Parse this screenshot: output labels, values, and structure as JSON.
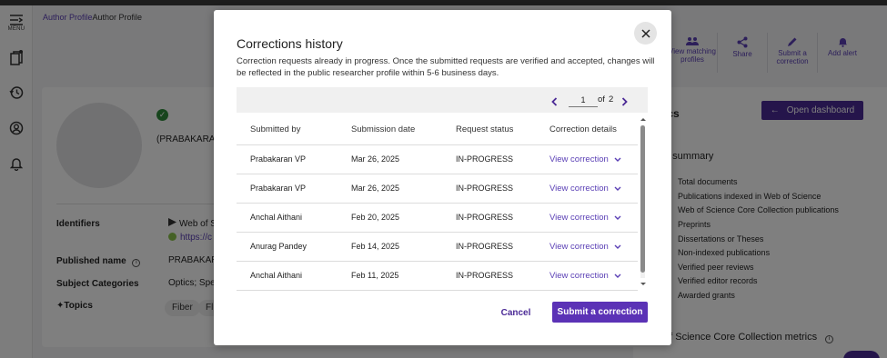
{
  "nav": {
    "menu_label": "MENU"
  },
  "breadcrumb": {
    "first": "Author Profile",
    "second": "Author Profile"
  },
  "actions": [
    {
      "label": "View matching profiles",
      "icon": "people-icon"
    },
    {
      "label": "Share",
      "icon": "share-icon"
    },
    {
      "label": "Submit a correction",
      "icon": "pencil-icon"
    },
    {
      "label": "Add alert",
      "icon": "bell-icon"
    }
  ],
  "profile": {
    "name_partial": "(PRABAKARAN,",
    "identifiers_label": "Identifiers",
    "identifier_source": "Web of S",
    "identifier_link": "https://c",
    "published_name_label": "Published name",
    "published_name_value": "PRABAKARAN",
    "subject_categories_label": "Subject Categories",
    "subject_categories_value": "Optics;  Spe",
    "topics_label": "Topics",
    "topic_chips": [
      "Fiber",
      "Fl"
    ]
  },
  "metrics": {
    "open_dashboard": "Open dashboard",
    "title": "ics",
    "summary_title": "e summary",
    "summary_items": [
      "Total documents",
      "Publications indexed in Web of Science",
      "Web of Science Core Collection publications",
      "Preprints",
      "Dissertations or Theses",
      "Non-indexed publications",
      "Verified peer reviews",
      "Verified editor records",
      "Awarded grants"
    ],
    "core_metrics": "of Science Core Collection metrics"
  },
  "modal": {
    "title": "Corrections history",
    "description": "Correction requests already in progress. Once the submitted requests are verified and accepted, changes will be reflected in the public researcher profile within 5-6 business days.",
    "pager": {
      "current": "1",
      "of_label": "of",
      "total": "2"
    },
    "columns": [
      "Submitted by",
      "Submission date",
      "Request status",
      "Correction details"
    ],
    "rows": [
      {
        "submitted_by": "Prabakaran VP",
        "date": "Mar 26, 2025",
        "status": "IN-PROGRESS",
        "details": "View correction"
      },
      {
        "submitted_by": "Prabakaran VP",
        "date": "Mar 26, 2025",
        "status": "IN-PROGRESS",
        "details": "View correction"
      },
      {
        "submitted_by": "Anchal Aithani",
        "date": "Feb 20, 2025",
        "status": "IN-PROGRESS",
        "details": "View correction"
      },
      {
        "submitted_by": "Anurag Pandey",
        "date": "Feb 14, 2025",
        "status": "IN-PROGRESS",
        "details": "View correction"
      },
      {
        "submitted_by": "Anchal Aithani",
        "date": "Feb 11, 2025",
        "status": "IN-PROGRESS",
        "details": "View correction"
      }
    ],
    "cancel_label": "Cancel",
    "submit_label": "Submit a correction"
  },
  "colors": {
    "accent": "#5b32b6",
    "dark_accent": "#4b2a96",
    "success": "#2e8b3b"
  }
}
